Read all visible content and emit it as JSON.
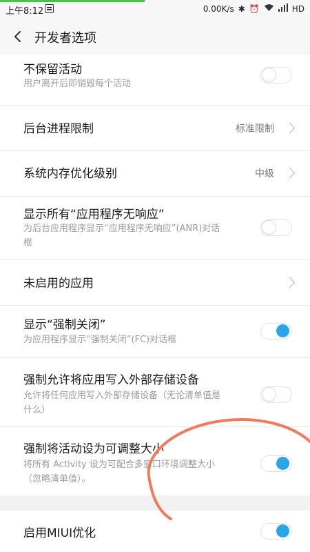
{
  "status_bar": {
    "time": "上午8:12",
    "network_speed": "0.00K/s",
    "network_type": "HD",
    "icons": [
      "notification-icon",
      "bluetooth-icon",
      "alarm-icon",
      "wifi-icon",
      "signal-icon",
      "battery-icon"
    ]
  },
  "header": {
    "title": "开发者选项"
  },
  "settings": {
    "dont_keep_activities": {
      "label": "不保留活动",
      "desc": "用户离开后即销毁每个活动",
      "enabled": false
    },
    "background_process_limit": {
      "label": "后台进程限制",
      "value": "标准限制"
    },
    "memory_optimization": {
      "label": "系统内存优化级别",
      "value": "中级"
    },
    "show_all_anrs": {
      "label": "显示所有“应用程序无响应”",
      "desc_line1": "为后台应用程序显示“应用程序无响应”(ANR)对话",
      "desc_line2": "框",
      "enabled": false
    },
    "inactive_apps": {
      "label": "未启用的应用"
    },
    "show_force_close": {
      "label": "显示“强制关闭”",
      "desc": "为应用程序显示“强制关闭”(FC)对话框",
      "enabled": true
    },
    "force_allow_external": {
      "label": "强制允许将应用写入外部存储设备",
      "desc_line1": "允许将任何应用写入外部存储设备（无论清单值是",
      "desc_line2": "什么）",
      "enabled": false
    },
    "force_resizable": {
      "label": "强制将活动设为可调整大小",
      "desc_line1": "将所有 Activity 设为可配合多窗口环境调整大小",
      "desc_line2": "（忽略清单值）。",
      "enabled": true
    },
    "miui_optimization": {
      "label": "启用MIUI优化",
      "enabled": true
    }
  },
  "colors": {
    "accent": "#2aa6e8",
    "annotation": "#ef7a5c"
  }
}
